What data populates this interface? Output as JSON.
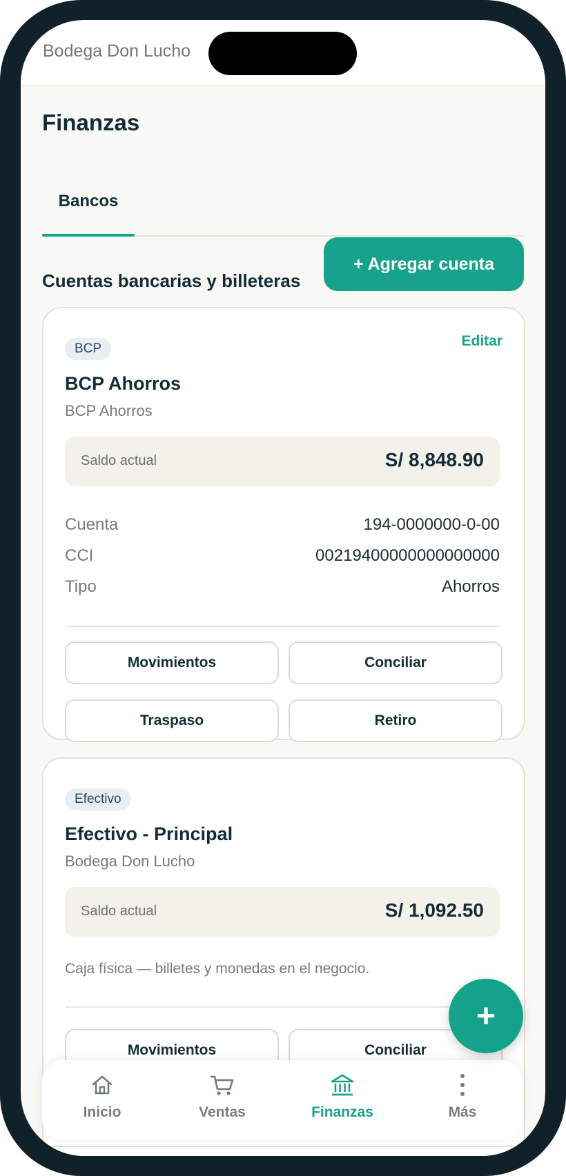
{
  "status_bar": {
    "store_name": "Bodega Don Lucho"
  },
  "page": {
    "title": "Finanzas"
  },
  "tabs": [
    {
      "label": "Bancos",
      "active": true
    }
  ],
  "section": {
    "title": "Cuentas bancarias y billeteras",
    "add_button": "+ Agregar cuenta"
  },
  "accounts": [
    {
      "badge": "BCP",
      "edit_label": "Editar",
      "name": "BCP Ahorros",
      "subtitle": "BCP Ahorros",
      "balance_label": "Saldo actual",
      "balance": "S/ 8,848.90",
      "details": [
        {
          "label": "Cuenta",
          "value": "194-0000000-0-00"
        },
        {
          "label": "CCI",
          "value": "00219400000000000000"
        },
        {
          "label": "Tipo",
          "value": "Ahorros"
        }
      ],
      "actions": [
        "Movimientos",
        "Conciliar",
        "Traspaso",
        "Retiro"
      ]
    },
    {
      "badge": "Efectivo",
      "name": "Efectivo - Principal",
      "subtitle": "Bodega Don Lucho",
      "balance_label": "Saldo actual",
      "balance": "S/ 1,092.50",
      "note": "Caja física — billetes y monedas en el negocio.",
      "actions": [
        "Movimientos",
        "Conciliar"
      ]
    }
  ],
  "fab": {
    "label": "+"
  },
  "bottom_nav": [
    {
      "label": "Inicio",
      "icon": "home-icon"
    },
    {
      "label": "Ventas",
      "icon": "cart-icon"
    },
    {
      "label": "Finanzas",
      "icon": "bank-icon",
      "active": true
    },
    {
      "label": "Más",
      "icon": "more-vertical-icon"
    }
  ],
  "colors": {
    "accent": "#17a38b",
    "text_primary": "#142c37",
    "text_secondary": "#767a7d",
    "phone_frame": "#112129",
    "balance_background": "#f3f1ea"
  }
}
